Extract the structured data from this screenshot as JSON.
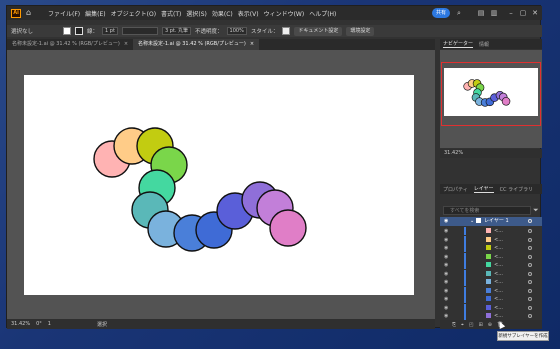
{
  "titlebar": {
    "logo": "Ai",
    "menu": [
      "ファイル(F)",
      "編集(E)",
      "オブジェクト(O)",
      "書式(T)",
      "選択(S)",
      "効果(C)",
      "表示(V)",
      "ウィンドウ(W)",
      "ヘルプ(H)"
    ],
    "share": "共有"
  },
  "controlbar": {
    "selection": "選択なし",
    "stroke_label": "線：",
    "stroke_value": "1 pt",
    "brush": "3 pt. 丸筆",
    "opacity_label": "不透明度：",
    "opacity_value": "100%",
    "style_label": "スタイル：",
    "doc_settings": "ドキュメント設定",
    "prefs": "環境設定"
  },
  "tabs": [
    {
      "label": "名称未設定-1.ai @ 31.42 % (RGB/プレビュー)",
      "close": "×"
    },
    {
      "label": "名称未設定-1.ai @ 31.42 % (RGB/プレビュー)",
      "close": "×"
    }
  ],
  "statusbar": {
    "zoom": "31.42%",
    "rotation": "0°",
    "artboard": "1",
    "tool": "選択"
  },
  "navigator": {
    "tabs": [
      "ナビゲーター",
      "情報"
    ],
    "zoom": "31.42%"
  },
  "layers": {
    "tabs": [
      "プロパティ",
      "レイヤー",
      "CC ライブラリ"
    ],
    "search_placeholder": "すべてを検索",
    "layer_name": "レイヤー 1",
    "item_label": "<...",
    "item_count": 11,
    "tooltip": "新規サブレイヤーを作成"
  },
  "artwork": {
    "circle_colors": [
      "#ffb3b3",
      "#ffcc88",
      "#c2cc11",
      "#7ad64a",
      "#44d8a0",
      "#5ab8b8",
      "#7ab2dd",
      "#4a7fd9",
      "#3f6bd6",
      "#5a5fd9",
      "#8f6fd9",
      "#c27fd9",
      "#e07ec7"
    ]
  }
}
